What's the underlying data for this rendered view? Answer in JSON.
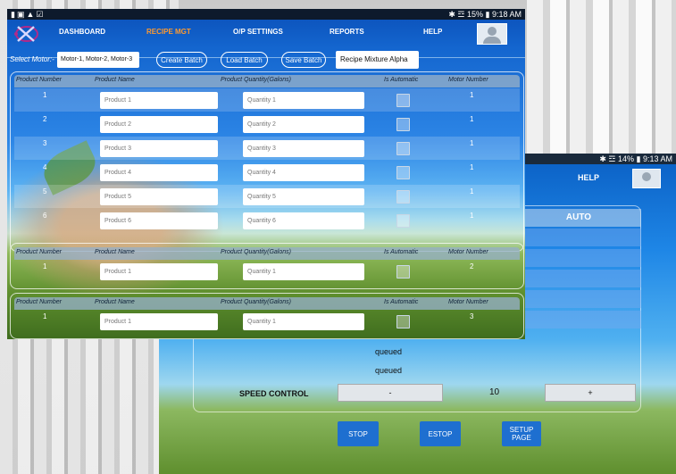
{
  "status": {
    "left_icons": [
      "sim-icon",
      "image-icon",
      "warning-icon",
      "check-icon"
    ],
    "right": "✱ ☲ 15% ▮ 9:18 AM",
    "back_right": "✱ ☲ 14% ▮ 9:13 AM"
  },
  "nav": {
    "items": [
      {
        "label": "DASHBOARD",
        "active": false
      },
      {
        "label": "RECIPE MGT",
        "active": true
      },
      {
        "label": "O/P SETTINGS",
        "active": false
      },
      {
        "label": "REPORTS",
        "active": false
      },
      {
        "label": "HELP",
        "active": false
      }
    ]
  },
  "toolbar": {
    "select_motor_label": "Select Motor:-",
    "motor_value": "Motor-1, Motor-2, Motor-3",
    "create_batch": "Create Batch",
    "load_batch": "Load Batch",
    "save_batch": "Save Batch",
    "recipe_name": "Recipe Mixture Alpha"
  },
  "table": {
    "headers": {
      "number": "Product Number",
      "name": "Product Name",
      "quantity": "Product Quantity(Galons)",
      "automatic": "Is Automatic",
      "motor": "Motor Number"
    },
    "rows": [
      {
        "num": "1",
        "name": "Product 1",
        "qty": "Quantity 1",
        "motor": "1"
      },
      {
        "num": "2",
        "name": "Product 2",
        "qty": "Quantity 2",
        "motor": "1"
      },
      {
        "num": "3",
        "name": "Product 3",
        "qty": "Quantity 3",
        "motor": "1"
      },
      {
        "num": "4",
        "name": "Product 4",
        "qty": "Quantity 4",
        "motor": "1"
      },
      {
        "num": "5",
        "name": "Product 5",
        "qty": "Quantity 5",
        "motor": "1"
      },
      {
        "num": "6",
        "name": "Product 6",
        "qty": "Quantity 6",
        "motor": "1"
      }
    ],
    "group2": {
      "num": "1",
      "name": "Product 1",
      "qty": "Quantity 1",
      "motor": "2"
    },
    "group3": {
      "num": "1",
      "name": "Product 1",
      "qty": "Quantity 1",
      "motor": "3"
    }
  },
  "back": {
    "help": "HELP",
    "auto_header": "AUTO",
    "queued_1": "queued",
    "queued_2": "queued",
    "speed_label": "SPEED CONTROL",
    "minus": "-",
    "speed_value": "10",
    "plus": "+",
    "stop": "STOP",
    "estop": "ESTOP",
    "setup_page": "SETUP PAGE"
  },
  "colors": {
    "accent_active": "#ff9a2e",
    "header_blue": "#0a4fb8",
    "button_blue": "#1e6fd0"
  }
}
